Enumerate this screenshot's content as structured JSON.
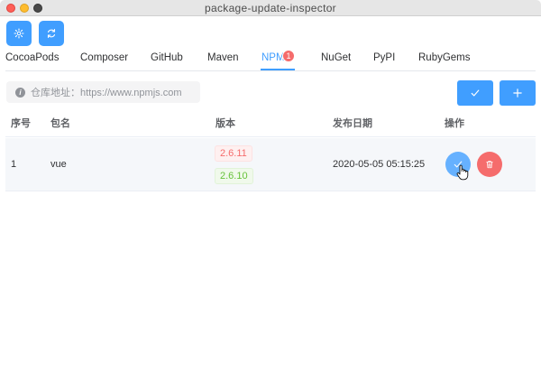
{
  "window": {
    "title": "package-update-inspector"
  },
  "toolbar": {
    "settings_icon": "gear-icon",
    "refresh_icon": "refresh-icon"
  },
  "tabs": [
    {
      "label": "CocoaPods",
      "active": false
    },
    {
      "label": "Composer",
      "active": false
    },
    {
      "label": "GitHub",
      "active": false
    },
    {
      "label": "Maven",
      "active": false
    },
    {
      "label": "NPM",
      "active": true,
      "badge": "1"
    },
    {
      "label": "NuGet",
      "active": false
    },
    {
      "label": "PyPI",
      "active": false
    },
    {
      "label": "RubyGems",
      "active": false
    }
  ],
  "repo": {
    "label": "仓库地址：https://www.npmjs.com"
  },
  "table": {
    "headers": {
      "index": "序号",
      "name": "包名",
      "version": "版本",
      "date": "发布日期",
      "actions": "操作"
    },
    "rows": [
      {
        "index": "1",
        "name": "vue",
        "latest_version": "2.6.11",
        "current_version": "2.6.10",
        "date": "2020-05-05 05:15:25"
      }
    ]
  },
  "colors": {
    "primary": "#409eff",
    "danger": "#f56c6c",
    "success": "#67c23a"
  }
}
